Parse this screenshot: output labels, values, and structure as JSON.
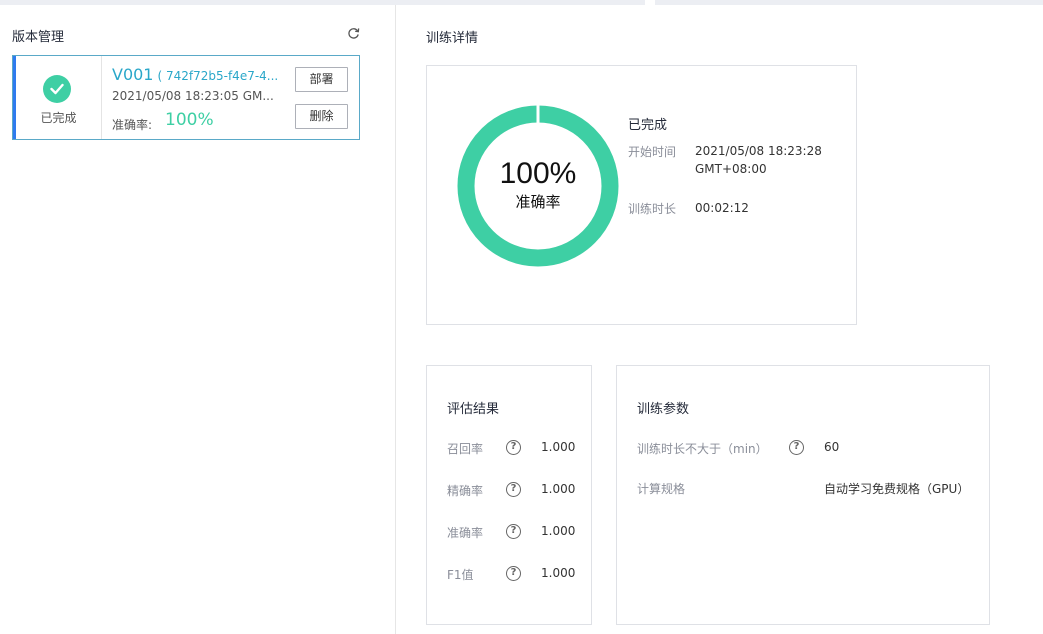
{
  "left_panel": {
    "title": "版本管理",
    "refresh_icon": "refresh-icon",
    "version": {
      "status": "已完成",
      "name": "V001",
      "hash": "( 742f72b5-f4e7-4...",
      "time": "2021/05/08 18:23:05 GM...",
      "accuracy_label": "准确率:",
      "accuracy_value": "100%",
      "deploy_label": "部署",
      "delete_label": "删除"
    }
  },
  "detail": {
    "title": "训练详情",
    "accuracy_percent": 100,
    "ring_value": "100%",
    "ring_label": "准确率",
    "status": "已完成",
    "start_label": "开始时间",
    "start_value_line1": "2021/05/08 18:23:28",
    "start_value_line2": "GMT+08:00",
    "duration_label": "训练时长",
    "duration_value": "00:02:12"
  },
  "evaluation": {
    "title": "评估结果",
    "metrics": [
      {
        "label": "召回率",
        "value": "1.000"
      },
      {
        "label": "精确率",
        "value": "1.000"
      },
      {
        "label": "准确率",
        "value": "1.000"
      },
      {
        "label": "F1值",
        "value": "1.000"
      }
    ]
  },
  "params": {
    "title": "训练参数",
    "items": [
      {
        "label": "训练时长不大于（min）",
        "value": "60",
        "has_help": true
      },
      {
        "label": "计算规格",
        "value": "自动学习免费规格（GPU）",
        "has_help": false
      }
    ]
  },
  "colors": {
    "accent_green": "#3ecfa4",
    "accent_blue": "#2f7bef",
    "link_teal": "#2aa7c9"
  }
}
